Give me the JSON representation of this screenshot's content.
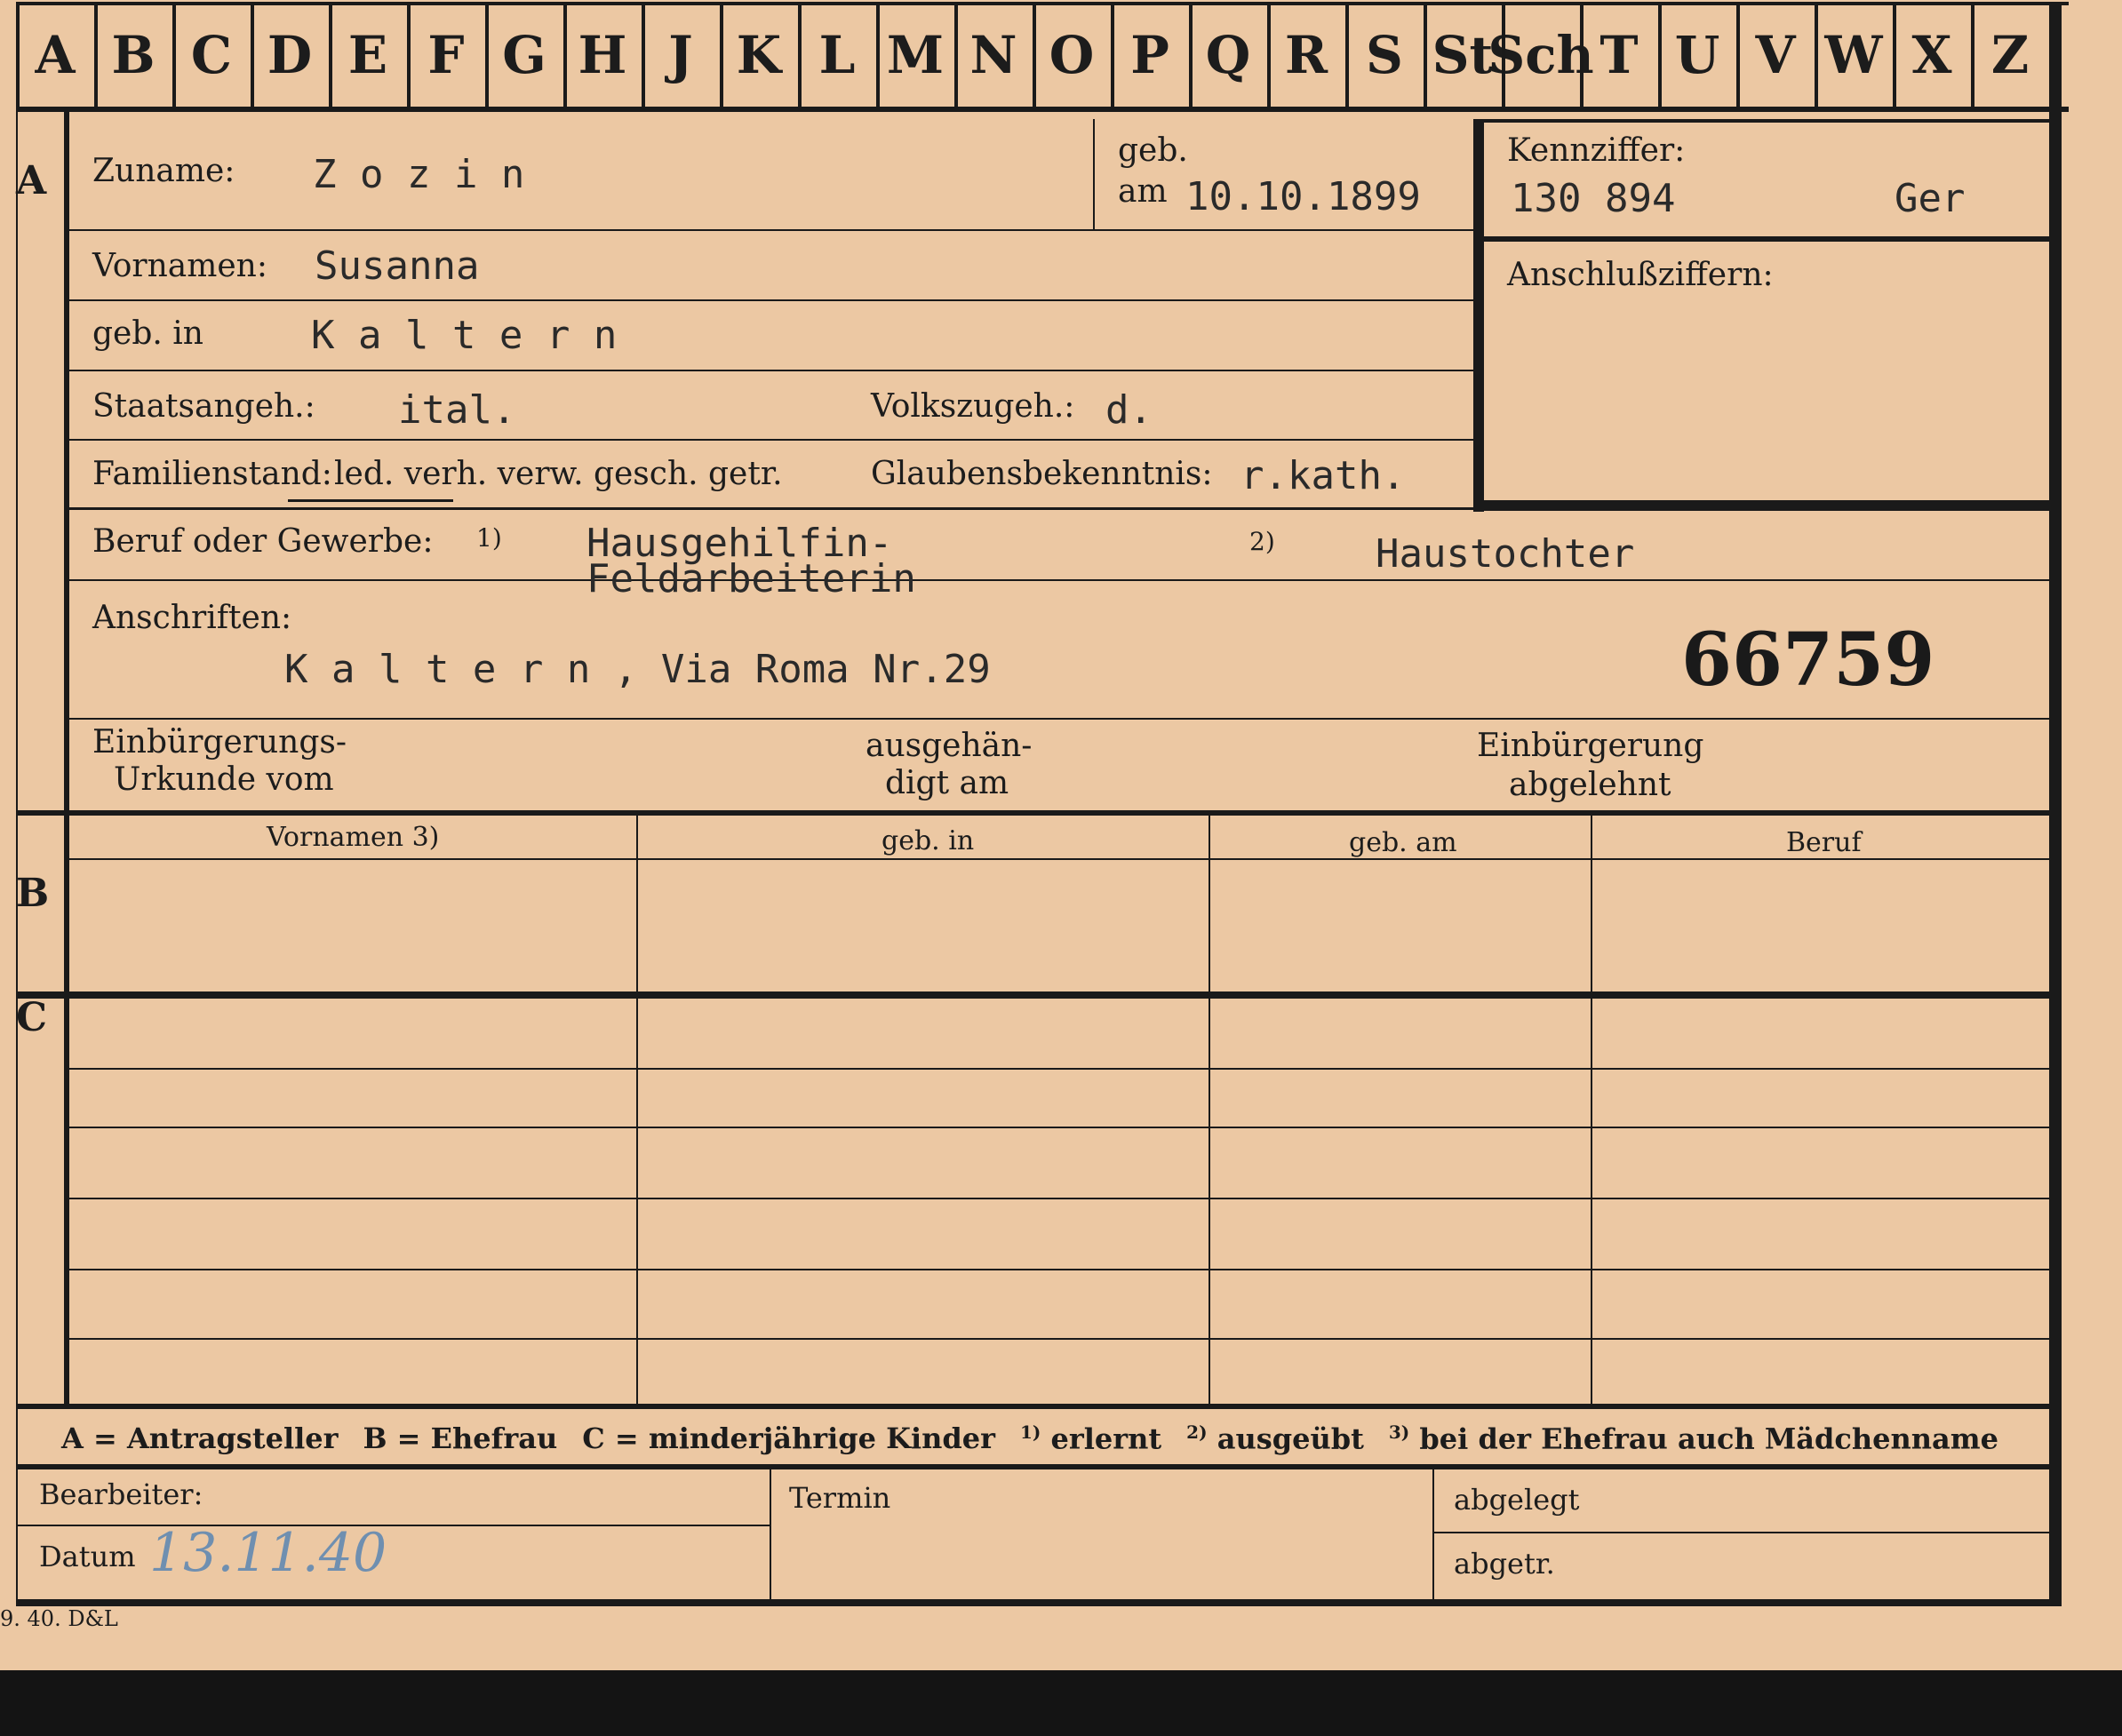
{
  "tabs": [
    "A",
    "B",
    "C",
    "D",
    "E",
    "F",
    "G",
    "H",
    "J",
    "K",
    "L",
    "M",
    "N",
    "O",
    "P",
    "Q",
    "R",
    "S",
    "St",
    "Sch",
    "T",
    "U",
    "V",
    "W",
    "X",
    "Z"
  ],
  "sections": {
    "a": "A",
    "b": "B",
    "c": "C"
  },
  "fields": {
    "surname_label": "Zuname:",
    "surname_value": "Z o z i n",
    "birth_label_1": "geb.",
    "birth_label_2": "am",
    "birth_value": "10.10.1899",
    "kennziffer_label": "Kennziffer:",
    "kennziffer_value": "130 894",
    "kennziffer_code": "Ger",
    "anschluss_label": "Anschlußziffern:",
    "firstname_label": "Vornamen:",
    "firstname_value": "Susanna",
    "birthplace_label": "geb. in",
    "birthplace_value": "K a l t e r n",
    "citizenship_label": "Staatsangeh.:",
    "citizenship_value": "ital.",
    "ethnicity_label": "Volkszugeh.:",
    "ethnicity_value": "d.",
    "marital_label": "Familienstand:",
    "marital_options": "led. verh. verw. gesch. getr.",
    "religion_label": "Glaubensbekenntnis:",
    "religion_value": "r.kath.",
    "occupation_label": "Beruf oder Gewerbe:",
    "occupation_note_1": "1)",
    "occupation_value_1a": "Hausgehilfin-",
    "occupation_value_1b": "Feldarbeiterin",
    "occupation_note_2": "2)",
    "occupation_value_2": "Haustochter",
    "address_label": "Anschriften:",
    "address_value": "K a l t e r n , Via Roma Nr.29",
    "file_number": "66759",
    "naturalization_label_1": "Einbürgerungs-",
    "naturalization_label_2": "Urkunde vom",
    "handed_label_1": "ausgehän-",
    "handed_label_2": "digt am",
    "rejected_label_1": "Einbürgerung",
    "rejected_label_2": "abgelehnt"
  },
  "table": {
    "columns": [
      "Vornamen 3)",
      "geb. in",
      "geb. am",
      "Beruf"
    ]
  },
  "legend": {
    "a": "A = Antragsteller",
    "b": "B = Ehefrau",
    "c": "C = minderjährige Kinder",
    "n1": "erlernt",
    "n2": "ausgeübt",
    "n3": "bei der Ehefrau auch Mädchenname"
  },
  "footer": {
    "bearbeiter_label": "Bearbeiter:",
    "datum_label": "Datum",
    "datum_value": "13.11.40",
    "termin_label": "Termin",
    "abgelegt_label": "abgelegt",
    "abgetr_label": "abgetr.",
    "print_code": "9. 40. D&L"
  },
  "colors": {
    "card": "#ecc8a3",
    "ink": "#1c1c1c",
    "handwriting": "#6f8fb0",
    "background": "#a7a198"
  }
}
